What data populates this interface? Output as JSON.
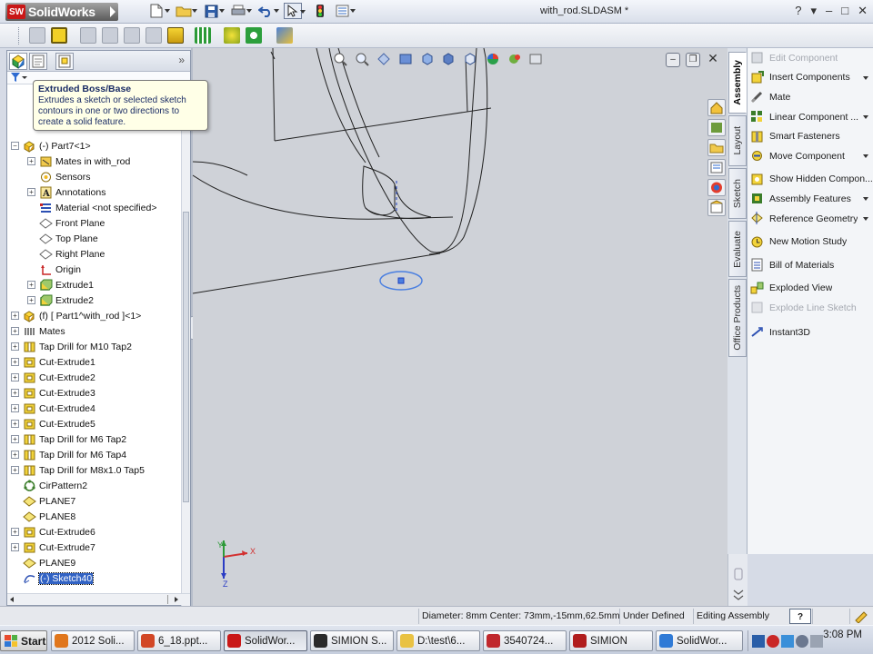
{
  "app": {
    "brand": "SolidWorks",
    "logo_mark": "SW",
    "document_title": "with_rod.SLDASM *",
    "window_controls": [
      "?",
      "▾",
      "–",
      "□",
      "✕"
    ]
  },
  "tooltip": {
    "title": "Extruded Boss/Base",
    "body": "Extrudes a sketch or selected sketch contours in one or two directions to create a solid feature."
  },
  "feature_tree": {
    "collapse_glyph": "»",
    "items": [
      {
        "label": "(-) Part7<1>",
        "indent": 0,
        "expand": "−",
        "icon": "part-icon"
      },
      {
        "label": "Mates in with_rod",
        "indent": 1,
        "expand": "+",
        "icon": "mates-folder-icon"
      },
      {
        "label": "Sensors",
        "indent": 1,
        "expand": "",
        "icon": "sensors-icon"
      },
      {
        "label": "Annotations",
        "indent": 1,
        "expand": "+",
        "icon": "annotations-icon"
      },
      {
        "label": "Material <not specified>",
        "indent": 1,
        "expand": "",
        "icon": "material-icon"
      },
      {
        "label": "Front Plane",
        "indent": 1,
        "expand": "",
        "icon": "plane-icon"
      },
      {
        "label": "Top Plane",
        "indent": 1,
        "expand": "",
        "icon": "plane-icon"
      },
      {
        "label": "Right Plane",
        "indent": 1,
        "expand": "",
        "icon": "plane-icon"
      },
      {
        "label": "Origin",
        "indent": 1,
        "expand": "",
        "icon": "origin-icon"
      },
      {
        "label": "Extrude1",
        "indent": 1,
        "expand": "+",
        "icon": "extrude-icon"
      },
      {
        "label": "Extrude2",
        "indent": 1,
        "expand": "+",
        "icon": "extrude-icon"
      },
      {
        "label": "(f) [ Part1^with_rod ]<1>",
        "indent": 0,
        "expand": "+",
        "icon": "part-icon"
      },
      {
        "label": "Mates",
        "indent": 0,
        "expand": "+",
        "icon": "mates-icon"
      },
      {
        "label": "Tap Drill for M10 Tap2",
        "indent": 0,
        "expand": "+",
        "icon": "hole-icon"
      },
      {
        "label": "Cut-Extrude1",
        "indent": 0,
        "expand": "+",
        "icon": "cut-extrude-icon"
      },
      {
        "label": "Cut-Extrude2",
        "indent": 0,
        "expand": "+",
        "icon": "cut-extrude-icon"
      },
      {
        "label": "Cut-Extrude3",
        "indent": 0,
        "expand": "+",
        "icon": "cut-extrude-icon"
      },
      {
        "label": "Cut-Extrude4",
        "indent": 0,
        "expand": "+",
        "icon": "cut-extrude-icon"
      },
      {
        "label": "Cut-Extrude5",
        "indent": 0,
        "expand": "+",
        "icon": "cut-extrude-icon"
      },
      {
        "label": "Tap Drill for M6 Tap2",
        "indent": 0,
        "expand": "+",
        "icon": "hole-icon"
      },
      {
        "label": "Tap Drill for M6 Tap4",
        "indent": 0,
        "expand": "+",
        "icon": "hole-icon"
      },
      {
        "label": "Tap Drill for M8x1.0 Tap5",
        "indent": 0,
        "expand": "+",
        "icon": "hole-icon"
      },
      {
        "label": "CirPattern2",
        "indent": 0,
        "expand": "",
        "icon": "pattern-icon"
      },
      {
        "label": "PLANE7",
        "indent": 0,
        "expand": "",
        "icon": "ref-plane-icon"
      },
      {
        "label": "PLANE8",
        "indent": 0,
        "expand": "",
        "icon": "ref-plane-icon"
      },
      {
        "label": "Cut-Extrude6",
        "indent": 0,
        "expand": "+",
        "icon": "cut-extrude-icon"
      },
      {
        "label": "Cut-Extrude7",
        "indent": 0,
        "expand": "+",
        "icon": "cut-extrude-icon"
      },
      {
        "label": "PLANE9",
        "indent": 0,
        "expand": "",
        "icon": "ref-plane-icon"
      },
      {
        "label": "(-) Sketch40",
        "indent": 0,
        "expand": "",
        "icon": "sketch-icon",
        "selected": true
      }
    ]
  },
  "taskpane": {
    "tabs": [
      "Assembly",
      "Layout",
      "Sketch",
      "Evaluate",
      "Office Products"
    ],
    "active_tab": "Assembly",
    "items": [
      {
        "label": "Edit Component",
        "disabled": true,
        "arrow": false,
        "icon": "edit-component-icon"
      },
      {
        "label": "Insert Components",
        "disabled": false,
        "arrow": true,
        "icon": "insert-components-icon"
      },
      {
        "label": "Mate",
        "disabled": false,
        "arrow": false,
        "icon": "mate-icon"
      },
      {
        "label": "Linear Component ...",
        "disabled": false,
        "arrow": true,
        "icon": "linear-pattern-icon"
      },
      {
        "label": "Smart Fasteners",
        "disabled": false,
        "arrow": false,
        "icon": "smart-fasteners-icon"
      },
      {
        "label": "Move Component",
        "disabled": false,
        "arrow": true,
        "icon": "move-component-icon"
      },
      {
        "label": "Show Hidden Compon...",
        "disabled": false,
        "arrow": false,
        "icon": "show-hidden-icon"
      },
      {
        "label": "Assembly Features",
        "disabled": false,
        "arrow": true,
        "icon": "assembly-features-icon"
      },
      {
        "label": "Reference Geometry",
        "disabled": false,
        "arrow": true,
        "icon": "reference-geometry-icon"
      },
      {
        "label": "New Motion Study",
        "disabled": false,
        "arrow": false,
        "icon": "motion-study-icon"
      },
      {
        "label": "Bill of Materials",
        "disabled": false,
        "arrow": false,
        "icon": "bom-icon"
      },
      {
        "label": "Exploded View",
        "disabled": false,
        "arrow": false,
        "icon": "exploded-view-icon"
      },
      {
        "label": "Explode Line Sketch",
        "disabled": true,
        "arrow": false,
        "icon": "explode-line-icon"
      },
      {
        "label": "Instant3D",
        "disabled": false,
        "arrow": false,
        "icon": "instant3d-icon"
      }
    ]
  },
  "triad": {
    "x": "X",
    "y": "Y",
    "z": "Z"
  },
  "status": {
    "sketch_info": "Diameter: 8mm  Center: 73mm,-15mm,62.5mm",
    "definition": "Under Defined",
    "mode": "Editing Assembly",
    "help_glyph": "?"
  },
  "taskbar": {
    "start": "Start",
    "tasks": [
      {
        "label": "2012 Soli...",
        "icon": "firefox-icon",
        "color": "#e0761c"
      },
      {
        "label": "6_18.ppt...",
        "icon": "powerpoint-icon",
        "color": "#d24726"
      },
      {
        "label": "SolidWor...",
        "icon": "solidworks-icon",
        "color": "#c91717",
        "active": true
      },
      {
        "label": "SIMION S...",
        "icon": "simion-icon",
        "color": "#2a2a2a"
      },
      {
        "label": "D:\\test\\6...",
        "icon": "folder-icon",
        "color": "#e9c243"
      },
      {
        "label": "3540724...",
        "icon": "pdf-icon",
        "color": "#c0282d"
      },
      {
        "label": "SIMION",
        "icon": "simion-icon",
        "color": "#b11d1d"
      },
      {
        "label": "SolidWor...",
        "icon": "ie-icon",
        "color": "#2f7ad6"
      }
    ],
    "clock": "3:08 PM"
  }
}
